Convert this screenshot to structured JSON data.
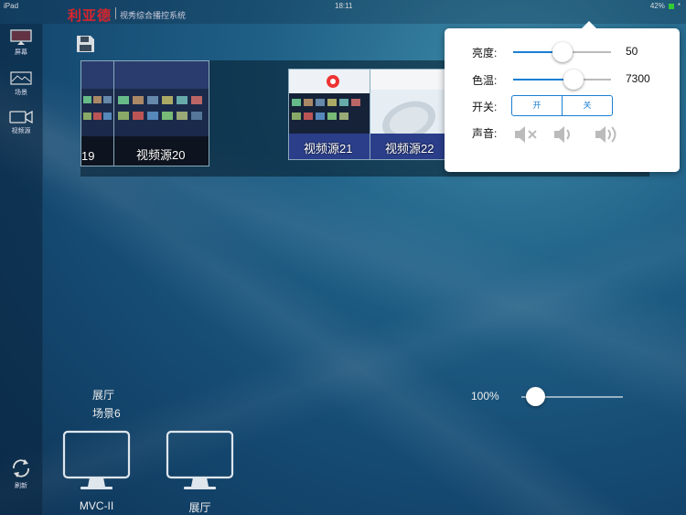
{
  "status": {
    "device": "iPad",
    "time": "18:11",
    "battery": "42%",
    "right_marker": "*"
  },
  "app": {
    "brand": "利亚德",
    "subtitle": "视秀综合播控系统"
  },
  "sidebar": {
    "items": [
      {
        "label": "屏幕",
        "icon": "monitor-icon"
      },
      {
        "label": "场景",
        "icon": "scene-icon"
      },
      {
        "label": "视频源",
        "icon": "video-camera-icon"
      }
    ],
    "refresh_label": "刷新"
  },
  "sources": [
    {
      "label": "19"
    },
    {
      "label": "视频源20"
    },
    {
      "label": "视频源21"
    },
    {
      "label": "视频源22"
    }
  ],
  "settings": {
    "brightness_label": "亮度:",
    "brightness_value": "50",
    "colortemp_label": "色温:",
    "colortemp_value": "7300",
    "power_label": "开关:",
    "power_on": "开",
    "power_off": "关",
    "sound_label": "声音:"
  },
  "zoom": {
    "value": "100%"
  },
  "scene": {
    "line1": "展厅",
    "line2": "场景6"
  },
  "screens": [
    {
      "label": "MVC-II"
    },
    {
      "label": "展厅"
    }
  ],
  "colors": {
    "brand": "#d7262e",
    "accent": "#1a7fd4"
  }
}
